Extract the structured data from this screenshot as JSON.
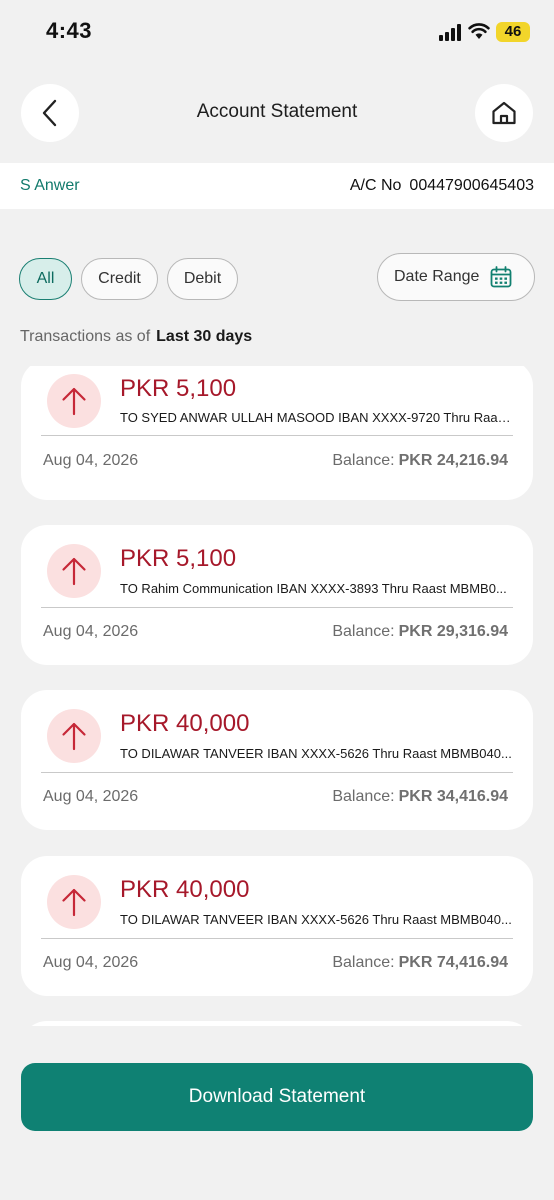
{
  "status_bar": {
    "time": "4:43",
    "battery": "46"
  },
  "header": {
    "title": "Account Statement",
    "back_icon": "chevron-left-icon",
    "home_icon": "home-icon"
  },
  "account": {
    "name": "S Anwer",
    "number_label": "A/C No",
    "number": "00447900645403"
  },
  "filters": {
    "chips": [
      "All",
      "Credit",
      "Debit"
    ],
    "selected": "All",
    "date_range_label": "Date Range",
    "date_range_icon": "calendar-icon"
  },
  "caption": {
    "prefix": "Transactions as of",
    "period": "Last 30 days"
  },
  "transactions": [
    {
      "amount": "PKR 5,100",
      "description": "TO SYED ANWAR ULLAH MASOOD IBAN XXXX-9720 Thru Raast...",
      "date": "Aug 04, 2026",
      "balance_label": "Balance:",
      "balance": "PKR 24,216.94",
      "direction": "debit"
    },
    {
      "amount": "PKR 5,100",
      "description": "TO Rahim Communication IBAN XXXX-3893 Thru Raast MBMB0...",
      "date": "Aug 04, 2026",
      "balance_label": "Balance:",
      "balance": "PKR 29,316.94",
      "direction": "debit"
    },
    {
      "amount": "PKR 40,000",
      "description": "TO DILAWAR TANVEER IBAN XXXX-5626 Thru Raast MBMB040...",
      "date": "Aug 04, 2026",
      "balance_label": "Balance:",
      "balance": "PKR 34,416.94",
      "direction": "debit"
    },
    {
      "amount": "PKR 40,000",
      "description": "TO DILAWAR TANVEER IBAN XXXX-5626 Thru Raast MBMB040...",
      "date": "Aug 04, 2026",
      "balance_label": "Balance:",
      "balance": "PKR 74,416.94",
      "direction": "debit"
    }
  ],
  "footer": {
    "download_label": "Download Statement"
  },
  "colors": {
    "accent": "#0f8173",
    "debit_amount": "#a6182a",
    "debit_badge": "#fbe0e0",
    "chip_active_bg": "#d7eeea"
  }
}
